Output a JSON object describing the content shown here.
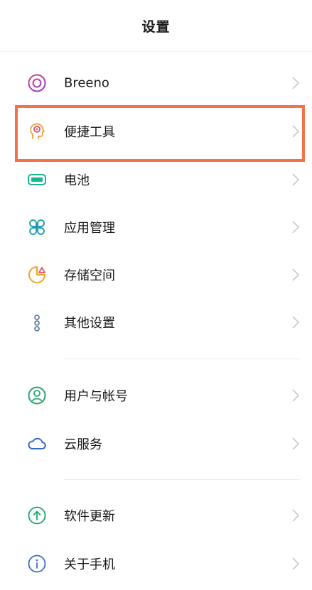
{
  "header": {
    "title": "设置"
  },
  "group1": [
    {
      "label": "Breeno",
      "icon": "breeno-icon"
    },
    {
      "label": "便捷工具",
      "icon": "convenience-tools-icon"
    },
    {
      "label": "电池",
      "icon": "battery-icon"
    },
    {
      "label": "应用管理",
      "icon": "app-management-icon"
    },
    {
      "label": "存储空间",
      "icon": "storage-icon"
    },
    {
      "label": "其他设置",
      "icon": "other-settings-icon"
    }
  ],
  "group2": [
    {
      "label": "用户与帐号",
      "icon": "user-account-icon"
    },
    {
      "label": "云服务",
      "icon": "cloud-icon"
    }
  ],
  "group3": [
    {
      "label": "软件更新",
      "icon": "software-update-icon"
    },
    {
      "label": "关于手机",
      "icon": "about-phone-icon"
    }
  ],
  "colors": {
    "breeno": "#c23fa8",
    "convenience": "#e8a33c",
    "battery": "#19b58e",
    "apps": "#15a88f",
    "storage": "#eba428",
    "other": "#4f6f8f",
    "user": "#2aa66f",
    "cloud": "#3367c9",
    "update": "#1fa66a",
    "about": "#3a6ec4",
    "highlight": "#f37249"
  }
}
